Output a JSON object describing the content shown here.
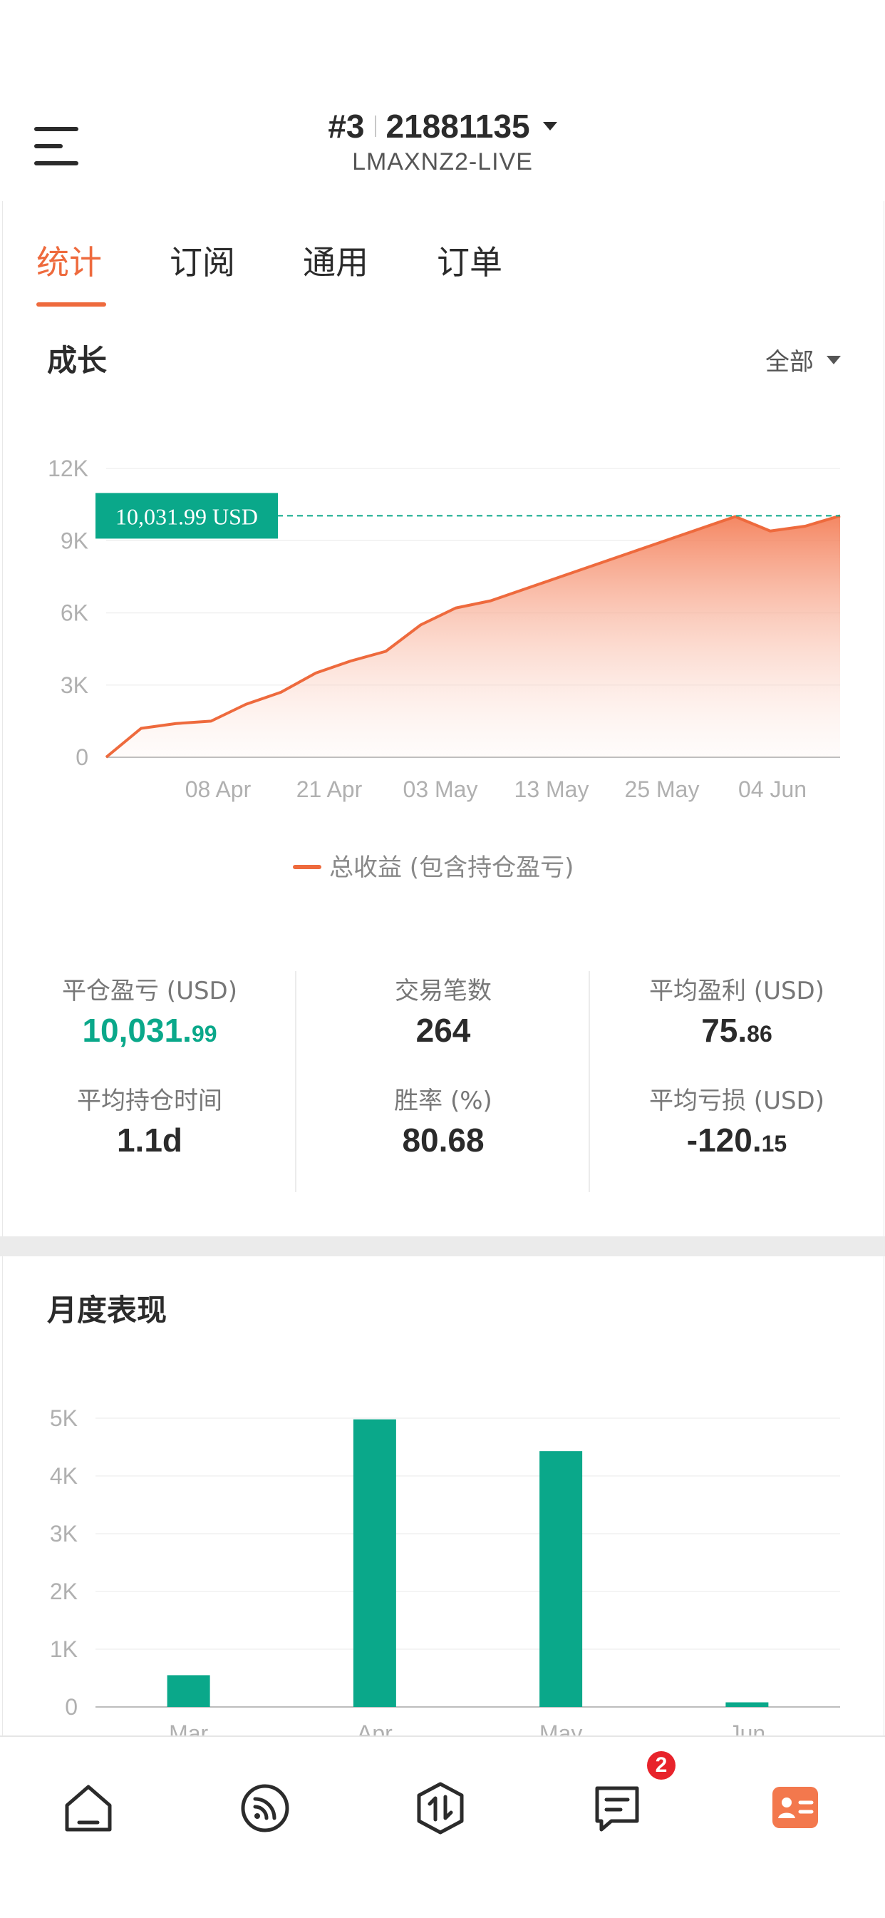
{
  "header": {
    "account_no": "#3",
    "account_id": "21881135",
    "server": "LMAXNZ2-LIVE"
  },
  "tabs": [
    {
      "label": "统计",
      "active": true
    },
    {
      "label": "订阅"
    },
    {
      "label": "通用"
    },
    {
      "label": "订单"
    }
  ],
  "growth": {
    "title": "成长",
    "range_label": "全部",
    "current_value_label": "10,031.99 USD",
    "legend": "总收益 (包含持仓盈亏)"
  },
  "stats": {
    "closed_pnl": {
      "label": "平仓盈亏 (USD)",
      "int": "10,031.",
      "dec": "99"
    },
    "trades": {
      "label": "交易笔数",
      "value": "264"
    },
    "avg_profit": {
      "label": "平均盈利 (USD)",
      "int": "75.",
      "dec": "86"
    },
    "avg_hold": {
      "label": "平均持仓时间",
      "value": "1.1d"
    },
    "win_rate": {
      "label": "胜率 (%)",
      "value": "80.68"
    },
    "avg_loss": {
      "label": "平均亏损 (USD)",
      "int": "-120.",
      "dec": "15"
    }
  },
  "monthly": {
    "title": "月度表现"
  },
  "colors": {
    "accent": "#ee6a3d",
    "green": "#0aa88a",
    "badge": "#e8232b"
  },
  "nav": [
    {
      "icon": "home-icon"
    },
    {
      "icon": "feed-icon"
    },
    {
      "icon": "trade-icon"
    },
    {
      "icon": "messages-icon",
      "badge": "2"
    },
    {
      "icon": "profile-card-icon",
      "active": true
    }
  ],
  "chart_data": [
    {
      "type": "area",
      "x": [
        "Mar 26",
        "Mar 29",
        "Apr 1",
        "Apr 4",
        "Apr 8",
        "Apr 12",
        "Apr 16",
        "Apr 21",
        "Apr 25",
        "Apr 29",
        "May 3",
        "May 6",
        "May 9",
        "May 13",
        "May 17",
        "May 21",
        "May 25",
        "May 29",
        "Jun 1",
        "Jun 4",
        "Jun 7",
        "Jun 10"
      ],
      "values": [
        0,
        1200,
        1400,
        1500,
        2200,
        2700,
        3500,
        4000,
        4400,
        5500,
        6200,
        6500,
        7000,
        7500,
        8000,
        8500,
        9000,
        9500,
        10000,
        9400,
        9600,
        10032
      ],
      "xticks": [
        "08 Apr",
        "21 Apr",
        "03 May",
        "13 May",
        "25 May",
        "04 Jun"
      ],
      "yticks": [
        "0",
        "3K",
        "6K",
        "9K",
        "12K"
      ],
      "ylim": [
        0,
        12000
      ],
      "series_name": "总收益 (包含持仓盈亏)",
      "current_value_label": "10,031.99 USD"
    },
    {
      "type": "bar",
      "categories": [
        "Mar",
        "Apr",
        "May",
        "Jun"
      ],
      "values": [
        550,
        4980,
        4430,
        80
      ],
      "yticks": [
        "0",
        "1K",
        "2K",
        "3K",
        "4K",
        "5K"
      ],
      "ylim": [
        0,
        5000
      ]
    }
  ]
}
